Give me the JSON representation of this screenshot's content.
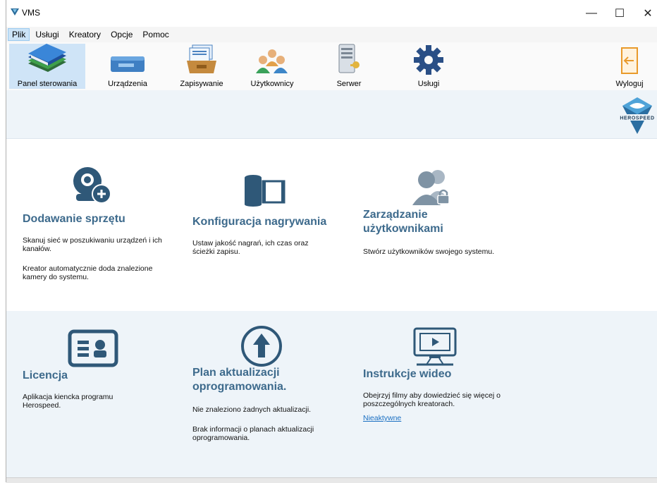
{
  "window": {
    "title": "VMS",
    "controls": {
      "minimize": "—",
      "maximize": "☐",
      "close": "✕"
    }
  },
  "menu": {
    "items": [
      {
        "label": "Plik",
        "active": true
      },
      {
        "label": "Usługi"
      },
      {
        "label": "Kreatory"
      },
      {
        "label": "Opcje"
      },
      {
        "label": "Pomoc"
      }
    ]
  },
  "toolbar": {
    "items": [
      {
        "label": "Panel sterowania",
        "icon": "books-icon",
        "active": true
      },
      {
        "label": "Urządzenia",
        "icon": "nvr-device-icon"
      },
      {
        "label": "Zapisywanie",
        "icon": "archive-box-icon"
      },
      {
        "label": "Użytkownicy",
        "icon": "users-icon"
      },
      {
        "label": "Serwer",
        "icon": "server-key-icon"
      },
      {
        "label": "Usługi",
        "icon": "gear-icon"
      }
    ],
    "logout": {
      "label": "Wyloguj",
      "icon": "logout-door-icon"
    }
  },
  "banner": {
    "logo_text": "HEROSPEED"
  },
  "cards": {
    "add_device": {
      "title": "Dodawanie sprzętu",
      "p1": "Skanuj sieć w poszukiwaniu urządzeń i ich kanałów.",
      "p2": "Kreator automatycznie doda znalezione kamery do systemu."
    },
    "recording": {
      "title": "Konfiguracja nagrywania",
      "p1": "Ustaw jakość nagrań, ich czas oraz ścieżki zapisu."
    },
    "users": {
      "title": "Zarządzanie użytkownikami",
      "p1": "Stwórz użytkowników swojego systemu."
    },
    "license": {
      "title": "Licencja",
      "p1": "Aplikacja kiencka programu Herospeed."
    },
    "update": {
      "title": "Plan aktualizacji oprogramowania.",
      "p1": "Nie znaleziono żadnych aktualizacji.",
      "p2": "Brak informacji o planach aktualizacji oprogramowania."
    },
    "video": {
      "title": "Instrukcje wideo",
      "p1": "Obejrzyj filmy aby dowiedzieć się więcej o poszczególnych kreatorach.",
      "link": "Nieaktywne"
    }
  },
  "colors": {
    "accent": "#3d6a8c",
    "icon": "#2f5878",
    "link": "#1a6fc2",
    "banner_bg": "#eef4f9",
    "active_bg": "#cfe4f7"
  }
}
